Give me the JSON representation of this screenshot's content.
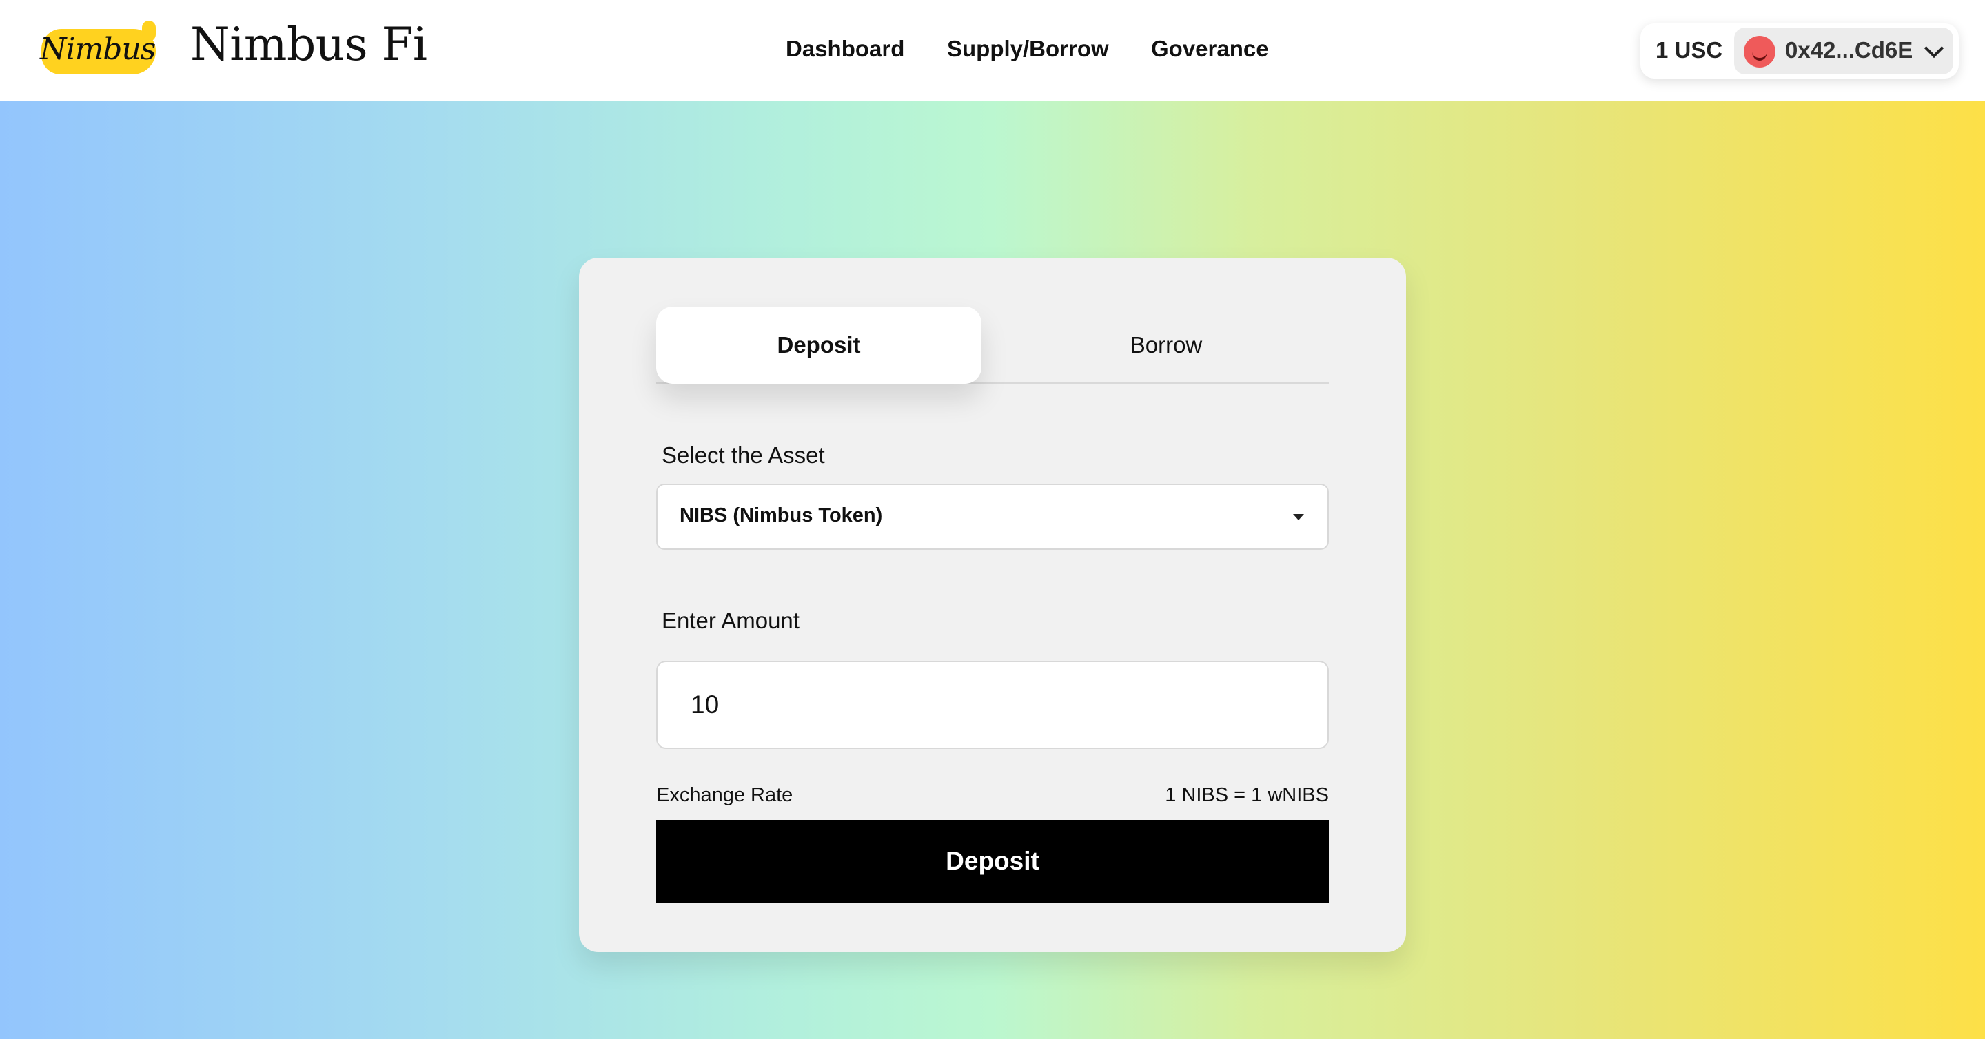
{
  "header": {
    "logo_text": "Nimbus",
    "brand": "Nimbus Fi",
    "nav": [
      {
        "label": "Dashboard"
      },
      {
        "label": "Supply/Borrow"
      },
      {
        "label": "Goverance"
      }
    ],
    "wallet": {
      "balance": "1 USC",
      "address": "0x42...Cd6E",
      "avatar_color": "#ef5a5a"
    }
  },
  "card": {
    "tabs": [
      {
        "label": "Deposit",
        "active": true
      },
      {
        "label": "Borrow",
        "active": false
      }
    ],
    "asset_label": "Select the Asset",
    "asset_selected": "NIBS (Nimbus Token)",
    "amount_label": "Enter Amount",
    "amount_value": "10",
    "exchange_rate_label": "Exchange Rate",
    "exchange_rate_value": "1 NIBS = 1 wNIBS",
    "submit_label": "Deposit"
  },
  "colors": {
    "logo_yellow": "#ffd21f",
    "gradient_start": "#93c5fd",
    "gradient_mid": "#bbf7d0",
    "gradient_end": "#fde047",
    "button_bg": "#000000"
  },
  "icons": {
    "account_dropdown": "chevron-down-icon",
    "asset_dropdown": "caret-down-icon"
  }
}
